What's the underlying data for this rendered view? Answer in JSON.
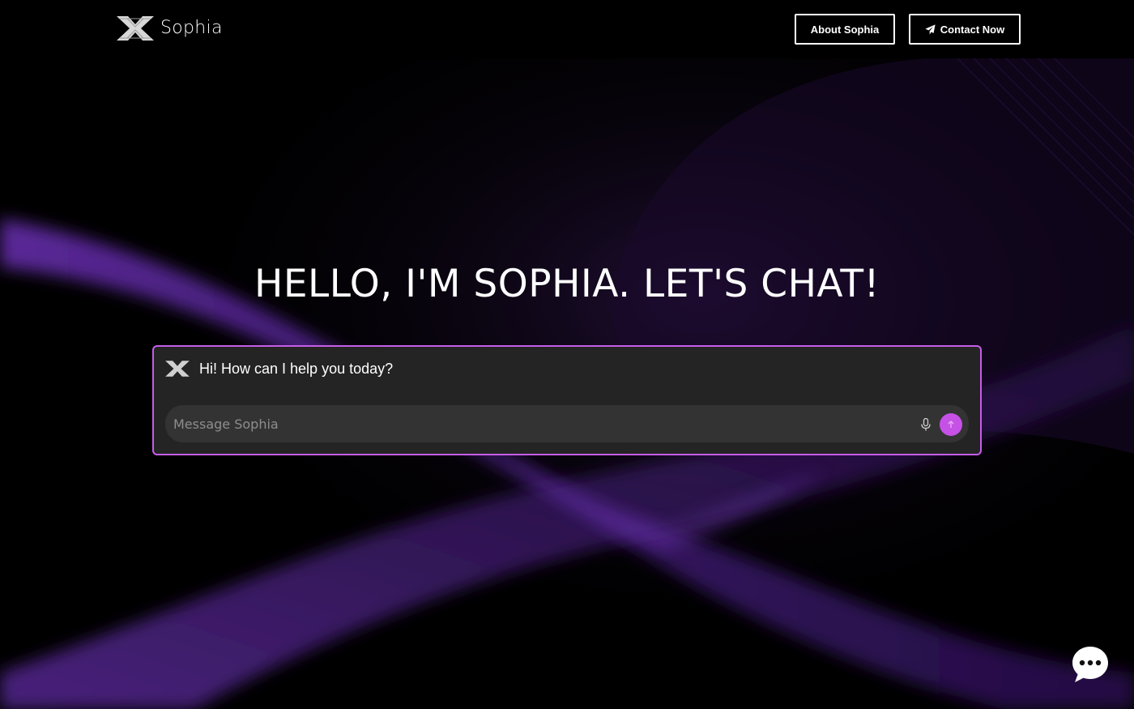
{
  "brand": {
    "name": "Sophia",
    "logo_icon": "x-logo-icon"
  },
  "nav": {
    "about_label": "About Sophia",
    "contact_label": "Contact Now",
    "contact_icon": "paper-plane-icon"
  },
  "hero": {
    "headline": "HELLO, I'M SOPHIA. LET'S CHAT!"
  },
  "chat": {
    "greeting": "Hi! How can I help you today?",
    "input_placeholder": "Message Sophia",
    "input_value": "",
    "mic_icon": "microphone-icon",
    "send_icon": "arrow-up-icon"
  },
  "launcher": {
    "icon": "chat-bubble-icon"
  },
  "colors": {
    "accent": "#c651e6",
    "panel_border": "#c65de8",
    "panel_bg": "#242424",
    "input_bg": "#333333",
    "background": "#000000",
    "wave": "#5a2a9a"
  }
}
